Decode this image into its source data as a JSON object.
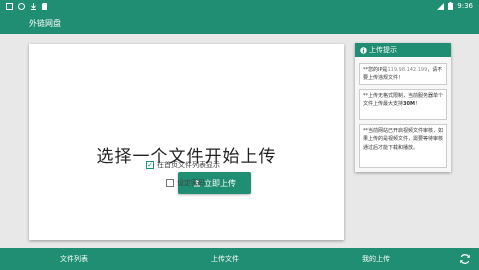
{
  "status_bar": {
    "left_icons": [
      "app-icon",
      "wifi-icon",
      "download-icon",
      "sd-icon"
    ],
    "time": "9:36",
    "right_icons": [
      "signal-icon",
      "battery-icon"
    ]
  },
  "app": {
    "title": "外链网盘"
  },
  "main": {
    "heading": "选择一个文件开始上传",
    "upload_label": "立即上传",
    "show_on_home_label": "在首页文件列表显示",
    "show_on_home_checked": true,
    "set_password_label": "设定密码",
    "set_password_checked": false
  },
  "tips": {
    "title": "上传提示",
    "tip1_a": "**您的IP是",
    "tip1_ip": "119.98.142.199",
    "tip1_b": "，请不要上传违规文件！",
    "tip2_a": "**上传无格式限制，当前服务器单个文件上传最大支持",
    "tip2_max": "30M",
    "tip2_b": "！",
    "tip3": "**当前网站已开启视频文件审核，如果上传的是视频文件，需要等待审核通过后才能下载和播放。"
  },
  "bottom_nav": {
    "file_list": "文件列表",
    "upload_file": "上传文件",
    "my_uploads": "我的上传"
  },
  "colors": {
    "primary": "#1f8e72"
  }
}
